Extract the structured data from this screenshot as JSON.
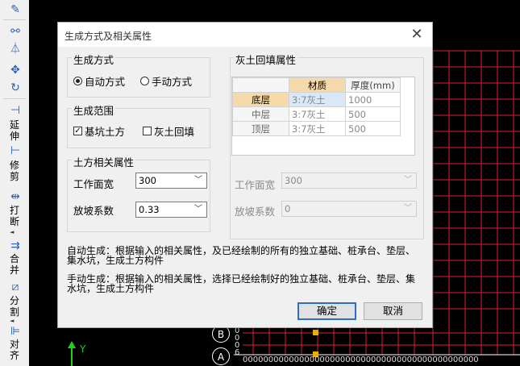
{
  "toolbar": {
    "items": [
      {
        "label": "延伸"
      },
      {
        "label": "修剪"
      },
      {
        "label": "打断"
      },
      {
        "label": "合并"
      },
      {
        "label": "分割"
      },
      {
        "label": "对齐"
      }
    ]
  },
  "canvas": {
    "axis_b": "B",
    "axis_a": "A",
    "y_axis_label": "Y",
    "dim_left": "0006",
    "dim_bottom": "0000000000000000000000000000000000000000000000"
  },
  "colors": {
    "grid": "#e0203a",
    "accent": "#2f6ec6",
    "table_header_active": "#f5d9a8"
  },
  "dialog": {
    "title": "生成方式及相关属性",
    "gen_mode": {
      "label": "生成方式",
      "auto": "自动方式",
      "manual": "手动方式",
      "selected": "自动方式"
    },
    "gen_range": {
      "label": "生成范围",
      "pit": "基坑土方",
      "pit_checked": true,
      "backfill": "灰土回填",
      "backfill_checked": false
    },
    "earth_props": {
      "label": "土方相关属性",
      "width_label": "工作面宽",
      "width_value": "300",
      "slope_label": "放坡系数",
      "slope_value": "0.33"
    },
    "lime_props": {
      "label": "灰土回填属性",
      "headers": [
        "材质",
        "厚度(mm)"
      ],
      "rows": [
        {
          "name": "底层",
          "material": "3:7灰土",
          "thickness": "1000"
        },
        {
          "name": "中层",
          "material": "3:7灰土",
          "thickness": "500"
        },
        {
          "name": "顶层",
          "material": "3:7灰土",
          "thickness": "500"
        }
      ],
      "width_label": "工作面宽",
      "width_value": "300",
      "slope_label": "放坡系数",
      "slope_value": "0"
    },
    "desc_auto_1": "自动生成：根据输入的相关属性，及已经绘制的所有的独立基础、桩承台、垫层、",
    "desc_auto_2": "集水坑，生成土方构件",
    "desc_manual_1": "手动生成：根据输入的相关属性，选择已经绘制好的独立基础、桩承台、垫层、集",
    "desc_manual_2": "水坑，生成土方构件",
    "ok": "确定",
    "cancel": "取消"
  }
}
